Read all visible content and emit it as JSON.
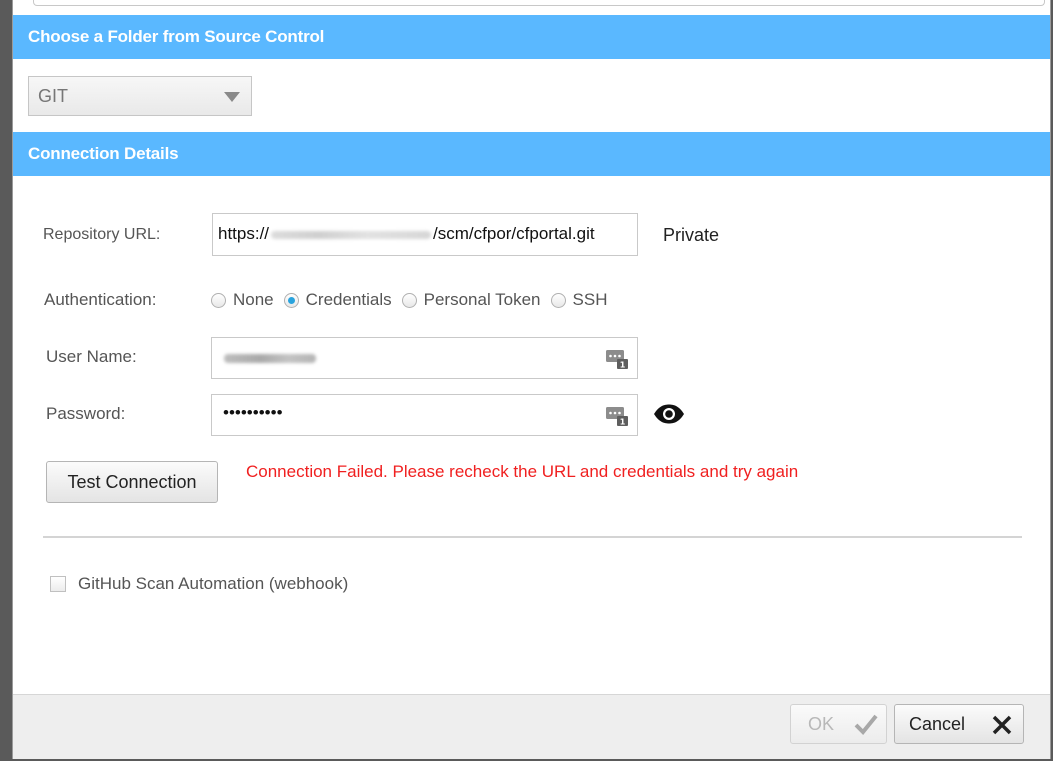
{
  "source_section": {
    "title": "Choose a Folder from Source Control",
    "scm_select_value": "GIT"
  },
  "connection_section": {
    "title": "Connection Details",
    "repository_url": {
      "label": "Repository URL:",
      "value_prefix": "https://",
      "value_suffix": "/scm/cfpor/cfportal.git",
      "visibility": "Private"
    },
    "authentication": {
      "label": "Authentication:",
      "options": [
        "None",
        "Credentials",
        "Personal Token",
        "SSH"
      ],
      "selected": "Credentials"
    },
    "user_name": {
      "label": "User Name:"
    },
    "password": {
      "label": "Password:",
      "masked_value": "••••••••••"
    },
    "test_connection_label": "Test Connection",
    "error_message": "Connection Failed. Please recheck the URL and credentials and try again",
    "webhook_checkbox_label": "GitHub Scan Automation (webhook)"
  },
  "footer": {
    "ok_label": "OK",
    "cancel_label": "Cancel"
  },
  "colors": {
    "header_blue": "#5ab8ff",
    "error_red": "#f02020",
    "radio_selected": "#2aa3dd"
  }
}
